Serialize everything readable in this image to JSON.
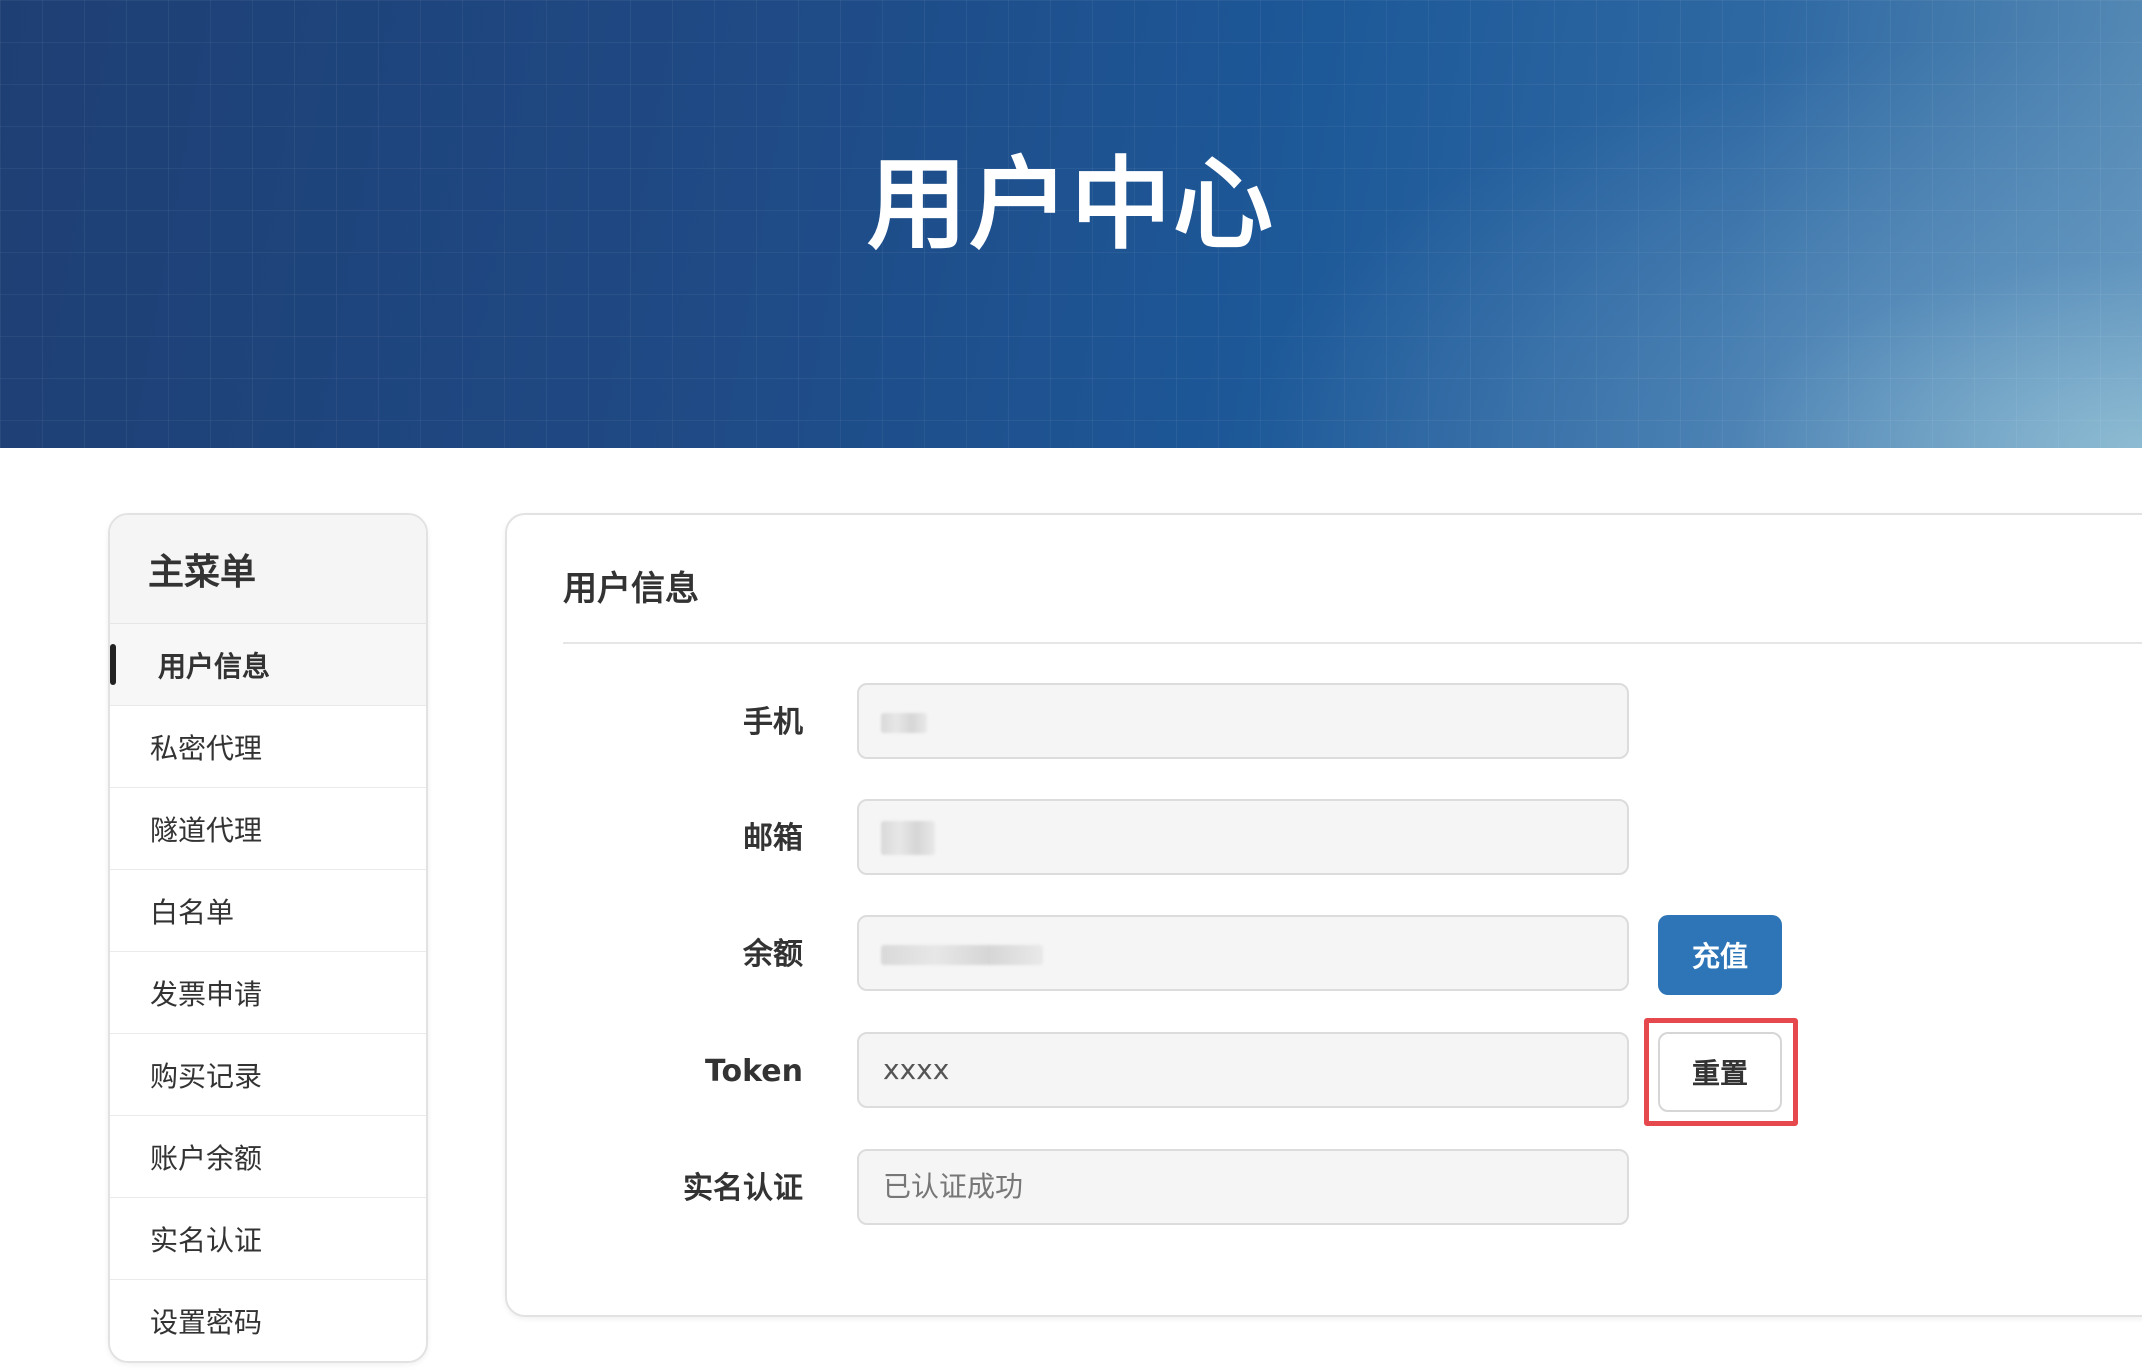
{
  "banner": {
    "title": "用户中心"
  },
  "sidebar": {
    "header": "主菜单",
    "items": [
      {
        "label": "用户信息",
        "active": true
      },
      {
        "label": "私密代理"
      },
      {
        "label": "隧道代理"
      },
      {
        "label": "白名单"
      },
      {
        "label": "发票申请"
      },
      {
        "label": "购买记录"
      },
      {
        "label": "账户余额"
      },
      {
        "label": "实名认证"
      },
      {
        "label": "设置密码"
      }
    ]
  },
  "main": {
    "title": "用户信息",
    "fields": {
      "phone": {
        "label": "手机",
        "value": ""
      },
      "email": {
        "label": "邮箱",
        "value": ""
      },
      "balance": {
        "label": "余额",
        "value": "",
        "button": "充值"
      },
      "token": {
        "label": "Token",
        "value": "xxxx",
        "button": "重置"
      },
      "verification": {
        "label": "实名认证",
        "placeholder": "已认证成功"
      }
    }
  },
  "colors": {
    "primary_button": "#2e75b8",
    "highlight": "#e5484d",
    "banner_dark": "#1e3f74"
  }
}
